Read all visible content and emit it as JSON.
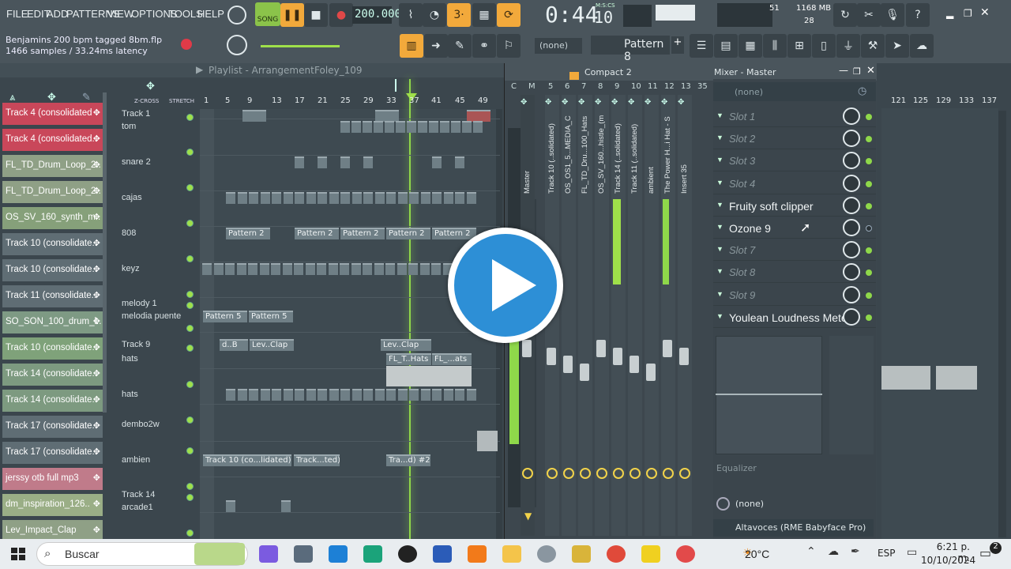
{
  "menu": [
    "FILE",
    "EDIT",
    "ADD",
    "PATTERNS",
    "VIEW",
    "OPTIONS",
    "TOOLS",
    "HELP"
  ],
  "transport": {
    "song_label": "SONG",
    "tempo": "200.000",
    "time": "0:44",
    "time_sub": "10",
    "time_unit": "M:S:CS"
  },
  "status": {
    "project": "Benjamins 200 bpm tagged 8bm.flp",
    "samples": "1466 samples / 33.24ms latency",
    "cpu_value": "51",
    "mem": "1168 MB",
    "voices": "28"
  },
  "pattern": {
    "none_label": "(none)",
    "pattern_name": "Pattern 8"
  },
  "playlist": {
    "title": "Playlist - Arrangement",
    "arrangement": "Foley_109",
    "ruler": [
      "1",
      "5",
      "9",
      "13",
      "17",
      "21",
      "25",
      "29",
      "33",
      "37",
      "41",
      "45",
      "49"
    ],
    "xcross": "Z-CROSS",
    "stretch": "STRETCH",
    "channels": [
      {
        "name": "Track 4 (consolidated",
        "color": "#c9475a"
      },
      {
        "name": "Track 4 (consolidated..",
        "color": "#c9475a"
      },
      {
        "name": "FL_TD_Drum_Loop_2..",
        "color": "#8fa086"
      },
      {
        "name": "FL_TD_Drum_Loop_2..",
        "color": "#8fa086"
      },
      {
        "name": "OS_SV_160_synth_m..",
        "color": "#86a07a"
      },
      {
        "name": "Track 10 (consolidate..",
        "color": "#5f6d74"
      },
      {
        "name": "Track 10 (consolidate..",
        "color": "#5f6d74"
      },
      {
        "name": "Track 11 (consolidate..",
        "color": "#5f6d74"
      },
      {
        "name": "SO_SON_100_drum_l..",
        "color": "#7e9a84"
      },
      {
        "name": "Track 10 (consolidate..",
        "color": "#7fa27a"
      },
      {
        "name": "Track 14 (consolidate..",
        "color": "#7d9a80"
      },
      {
        "name": "Track 14 (consolidate..",
        "color": "#7d9a80"
      },
      {
        "name": "Track 17 (consolidate..",
        "color": "#5f6d74"
      },
      {
        "name": "Track 17 (consolidate..",
        "color": "#5f6d74"
      },
      {
        "name": "jerssy otb full mp3",
        "color": "#c07b8a"
      },
      {
        "name": "dm_inspiration_126..",
        "color": "#9aae86"
      },
      {
        "name": "Lev_Impact_Clap",
        "color": "#8fa086"
      }
    ],
    "tracks": [
      "Track 1",
      "tom",
      "snare 2",
      "cajas",
      "808",
      "keyz",
      "melody 1",
      "melodia puente",
      "Track 9",
      "hats",
      "hats",
      "dembo2w",
      "ambien",
      "Track 14",
      "arcade1"
    ],
    "clip_labels": {
      "pattern2": "Pattern 2",
      "pattern5": "Pattern 5",
      "lev_clap": "Lev..Clap",
      "d_b": "d..B",
      "fl_t_hats": "FL_T..Hats",
      "fl_ats": "FL_...ats",
      "ambien_clip": "Track 10 (co...lidated) #2",
      "track_ted": "Track...ted) #2",
      "tra_d": "Tra...d) #2"
    }
  },
  "mixer": {
    "compact": "Compact 2",
    "title": "Mixer - Master",
    "strip_numbers": [
      "C",
      "M",
      "5",
      "6",
      "7",
      "8",
      "9",
      "10",
      "11",
      "12",
      "13",
      "35"
    ],
    "strips": [
      "Master",
      "Track 10 (..solidated)",
      "OS_OS1_5...MEDIA_C",
      "FL_TD_Dru...100_Hats",
      "OS_SV_160...histle_(m",
      "Track 14 (..solidated)",
      "Track 11 (..solidated)",
      "ambient",
      "The Power H...i Hat - S",
      "Insert 35"
    ],
    "none_label": "(none)",
    "slots": [
      {
        "label": "Slot 1",
        "active": false
      },
      {
        "label": "Slot 2",
        "active": false
      },
      {
        "label": "Slot 3",
        "active": false
      },
      {
        "label": "Slot 4",
        "active": false
      },
      {
        "label": "Fruity soft clipper",
        "active": true
      },
      {
        "label": "Ozone 9",
        "active": true
      },
      {
        "label": "Slot 7",
        "active": false
      },
      {
        "label": "Slot 8",
        "active": false
      },
      {
        "label": "Slot 9",
        "active": false
      },
      {
        "label": "Youlean Loudness Mete...",
        "active": true
      }
    ],
    "equalizer": "Equalizer",
    "output_none": "(none)",
    "device": "Altavoces (RME Babyface Pro)"
  },
  "right_ruler": [
    "121",
    "125",
    "129",
    "133",
    "137"
  ],
  "taskbar": {
    "search": "Buscar",
    "weather": "20°C",
    "lang": "ESP",
    "time": "6:21 p. m.",
    "date": "10/10/2024",
    "badge": "2"
  }
}
